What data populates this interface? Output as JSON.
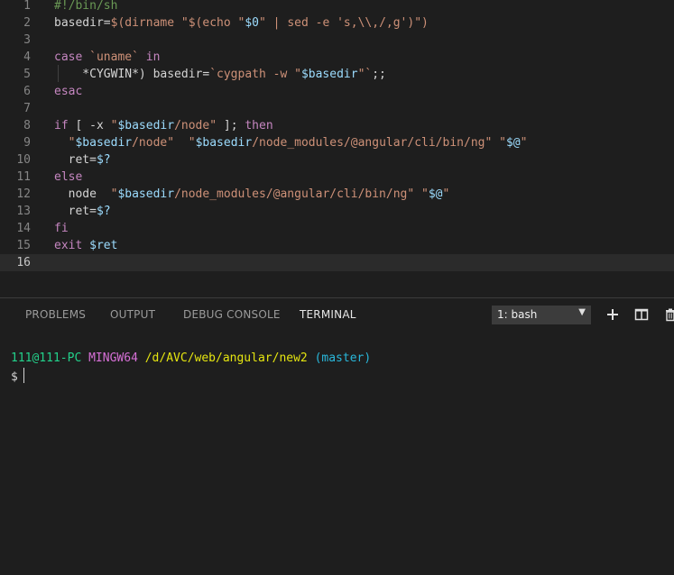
{
  "editor": {
    "current_line": 16,
    "lines": [
      {
        "n": "1",
        "tokens": [
          {
            "t": "#!/bin/sh",
            "c": "#6a9955"
          }
        ]
      },
      {
        "n": "2",
        "tokens": [
          {
            "t": "basedir=",
            "c": "#d4d4d4"
          },
          {
            "t": "$(dirname ",
            "c": "#ce9178"
          },
          {
            "t": "\"$(echo \"",
            "c": "#ce9178"
          },
          {
            "t": "$0",
            "c": "#9cdcfe"
          },
          {
            "t": "\" | sed -e 's,\\\\,/,g')\")",
            "c": "#ce9178"
          }
        ]
      },
      {
        "n": "3",
        "tokens": []
      },
      {
        "n": "4",
        "tokens": [
          {
            "t": "case",
            "c": "#c586c0"
          },
          {
            "t": " `uname` ",
            "c": "#ce9178"
          },
          {
            "t": "in",
            "c": "#c586c0"
          }
        ]
      },
      {
        "n": "5",
        "tokens": [
          {
            "t": "    *CYGWIN*) basedir=",
            "c": "#d4d4d4"
          },
          {
            "t": "`cygpath -w \"",
            "c": "#ce9178"
          },
          {
            "t": "$basedir",
            "c": "#9cdcfe"
          },
          {
            "t": "\"`",
            "c": "#ce9178"
          },
          {
            "t": ";;",
            "c": "#d4d4d4"
          }
        ]
      },
      {
        "n": "6",
        "tokens": [
          {
            "t": "esac",
            "c": "#c586c0"
          }
        ]
      },
      {
        "n": "7",
        "tokens": []
      },
      {
        "n": "8",
        "tokens": [
          {
            "t": "if",
            "c": "#c586c0"
          },
          {
            "t": " [ -x ",
            "c": "#d4d4d4"
          },
          {
            "t": "\"",
            "c": "#ce9178"
          },
          {
            "t": "$basedir",
            "c": "#9cdcfe"
          },
          {
            "t": "/node\"",
            "c": "#ce9178"
          },
          {
            "t": " ]; ",
            "c": "#d4d4d4"
          },
          {
            "t": "then",
            "c": "#c586c0"
          }
        ]
      },
      {
        "n": "9",
        "tokens": [
          {
            "t": "  ",
            "c": "#d4d4d4"
          },
          {
            "t": "\"",
            "c": "#ce9178"
          },
          {
            "t": "$basedir",
            "c": "#9cdcfe"
          },
          {
            "t": "/node\"",
            "c": "#ce9178"
          },
          {
            "t": "  ",
            "c": "#d4d4d4"
          },
          {
            "t": "\"",
            "c": "#ce9178"
          },
          {
            "t": "$basedir",
            "c": "#9cdcfe"
          },
          {
            "t": "/node_modules/@angular/cli/bin/ng\"",
            "c": "#ce9178"
          },
          {
            "t": " ",
            "c": "#d4d4d4"
          },
          {
            "t": "\"",
            "c": "#ce9178"
          },
          {
            "t": "$@",
            "c": "#9cdcfe"
          },
          {
            "t": "\"",
            "c": "#ce9178"
          }
        ]
      },
      {
        "n": "10",
        "tokens": [
          {
            "t": "  ret=",
            "c": "#d4d4d4"
          },
          {
            "t": "$?",
            "c": "#9cdcfe"
          }
        ]
      },
      {
        "n": "11",
        "tokens": [
          {
            "t": "else",
            "c": "#c586c0"
          }
        ]
      },
      {
        "n": "12",
        "tokens": [
          {
            "t": "  node  ",
            "c": "#d4d4d4"
          },
          {
            "t": "\"",
            "c": "#ce9178"
          },
          {
            "t": "$basedir",
            "c": "#9cdcfe"
          },
          {
            "t": "/node_modules/@angular/cli/bin/ng\"",
            "c": "#ce9178"
          },
          {
            "t": " ",
            "c": "#d4d4d4"
          },
          {
            "t": "\"",
            "c": "#ce9178"
          },
          {
            "t": "$@",
            "c": "#9cdcfe"
          },
          {
            "t": "\"",
            "c": "#ce9178"
          }
        ]
      },
      {
        "n": "13",
        "tokens": [
          {
            "t": "  ret=",
            "c": "#d4d4d4"
          },
          {
            "t": "$?",
            "c": "#9cdcfe"
          }
        ]
      },
      {
        "n": "14",
        "tokens": [
          {
            "t": "fi",
            "c": "#c586c0"
          }
        ]
      },
      {
        "n": "15",
        "tokens": [
          {
            "t": "exit ",
            "c": "#c586c0"
          },
          {
            "t": "$ret",
            "c": "#9cdcfe"
          }
        ]
      },
      {
        "n": "16",
        "tokens": []
      }
    ]
  },
  "panel": {
    "tabs": [
      {
        "label": "PROBLEMS",
        "active": false
      },
      {
        "label": "OUTPUT",
        "active": false
      },
      {
        "label": "DEBUG CONSOLE",
        "active": false
      },
      {
        "label": "TERMINAL",
        "active": true
      }
    ],
    "terminal_select": "1: bash",
    "icons": [
      "plus-icon",
      "split-icon",
      "trash-icon"
    ]
  },
  "terminal": {
    "user_host": "111@111-PC",
    "env": "MINGW64",
    "path": "/d/AVC/web/angular/new2",
    "branch": "(master)",
    "prompt_symbol": "$",
    "colors": {
      "user": "#23d18b",
      "env": "#d670d6",
      "path": "#e5e510",
      "branch": "#29b8db"
    }
  }
}
